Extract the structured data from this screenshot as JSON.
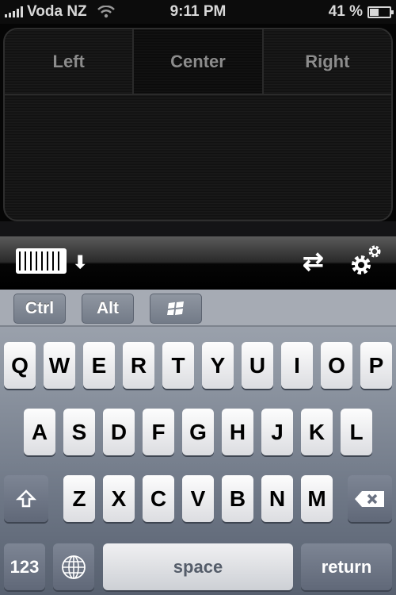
{
  "status_bar": {
    "carrier": "Voda NZ",
    "time": "9:11 PM",
    "battery_percent_label": "41 %",
    "battery_level": 0.41,
    "signal_bars": 5,
    "wifi_icon": "wifi-icon",
    "battery_icon": "battery-charging-icon"
  },
  "trackpad": {
    "buttons": [
      "Left",
      "Center",
      "Right"
    ]
  },
  "toolbar": {
    "keyboard_toggle_icon": "keyboard-hide-icon",
    "down_arrow": "⬇",
    "swap_icon": "⇄",
    "settings_icon": "gear-icon"
  },
  "modifiers": {
    "ctrl": "Ctrl",
    "alt": "Alt",
    "windows_icon": "windows-logo-icon"
  },
  "keyboard": {
    "row1": [
      "Q",
      "W",
      "E",
      "R",
      "T",
      "Y",
      "U",
      "I",
      "O",
      "P"
    ],
    "row2": [
      "A",
      "S",
      "D",
      "F",
      "G",
      "H",
      "J",
      "K",
      "L"
    ],
    "row3": [
      "Z",
      "X",
      "C",
      "V",
      "B",
      "N",
      "M"
    ],
    "numbers": "123",
    "space": "space",
    "return": "return"
  }
}
